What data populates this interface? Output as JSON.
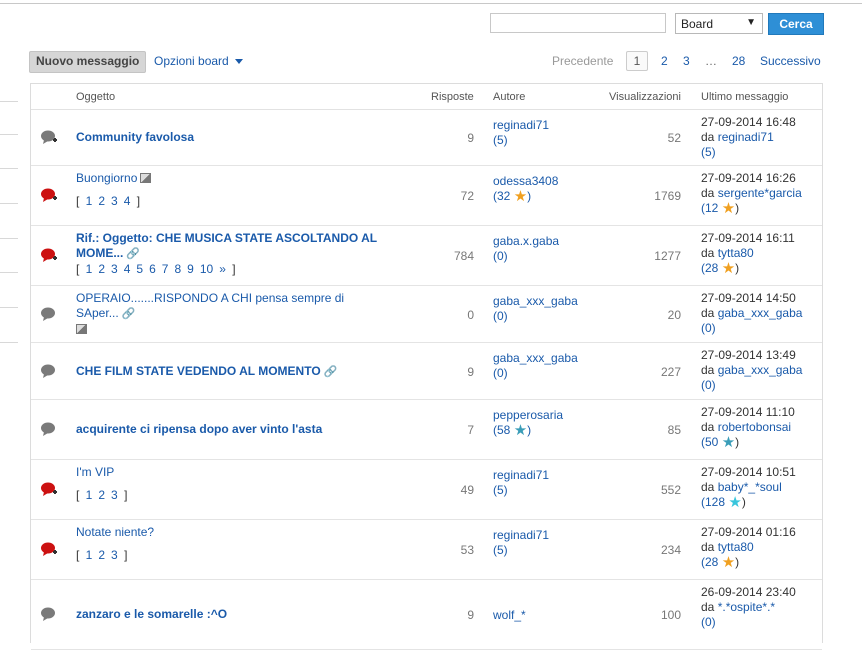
{
  "search": {
    "input_value": "",
    "scope_selected": "Board",
    "button_label": "Cerca"
  },
  "toolbar": {
    "new_message_label": "Nuovo messaggio",
    "board_options_label": "Opzioni board"
  },
  "pagination": {
    "prev": "Precedente",
    "current": "1",
    "p2": "2",
    "p3": "3",
    "ellipsis": "…",
    "last": "28",
    "next": "Successivo"
  },
  "columns": {
    "subject": "Oggetto",
    "replies": "Risposte",
    "author": "Autore",
    "views": "Visualizzazioni",
    "last_message": "Ultimo messaggio"
  },
  "threads": [
    {
      "icon": "chat-grey-new-icon",
      "title": "Community favolosa",
      "bold": true,
      "pages": null,
      "replies": "9",
      "author": "reginadi71",
      "author_count": "(5)",
      "views": "52",
      "last_date": "27-09-2014 16:48",
      "last_prefix": "da",
      "last_user": "reginadi71",
      "last_count": "(5)"
    },
    {
      "icon": "chat-red-hot-new-icon",
      "title": "Buongiorno",
      "bold": false,
      "pages": [
        "1",
        "2",
        "3",
        "4"
      ],
      "replies": "72",
      "author": "odessa3408",
      "author_count": "(32",
      "author_star": "gold",
      "views": "1769",
      "last_date": "27-09-2014 16:26",
      "last_prefix": "da",
      "last_user": "sergente*garcia",
      "last_count": "(12",
      "last_star": "gold"
    },
    {
      "icon": "chat-red-hot-new-icon",
      "title": "Rif.: Oggetto: CHE MUSICA STATE ASCOLTANDO AL MOME...",
      "bold": true,
      "pages": [
        "1",
        "2",
        "3",
        "4",
        "5",
        "6",
        "7",
        "8",
        "9",
        "10",
        "»"
      ],
      "replies": "784",
      "author": "gaba.x.gaba",
      "author_count": "(0)",
      "views": "1277",
      "last_date": "27-09-2014 16:11",
      "last_prefix": "da",
      "last_user": "tytta80",
      "last_count": "(28",
      "last_star": "gold"
    },
    {
      "icon": "chat-grey-icon",
      "title": "OPERAIO.......RISPONDO A CHI pensa sempre di SAper...",
      "bold": false,
      "pages": null,
      "replies": "0",
      "author": "gaba_xxx_gaba",
      "author_count": "(0)",
      "views": "20",
      "last_date": "27-09-2014 14:50",
      "last_prefix": "da",
      "last_user": "gaba_xxx_gaba",
      "last_count": "(0)"
    },
    {
      "icon": "chat-grey-icon",
      "title": "CHE FILM STATE VEDENDO AL MOMENTO",
      "bold": true,
      "pages": null,
      "replies": "9",
      "author": "gaba_xxx_gaba",
      "author_count": "(0)",
      "views": "227",
      "last_date": "27-09-2014 13:49",
      "last_prefix": "da",
      "last_user": "gaba_xxx_gaba",
      "last_count": "(0)"
    },
    {
      "icon": "chat-grey-icon",
      "title": "acquirente ci ripensa dopo aver vinto l'asta",
      "bold": true,
      "pages": null,
      "replies": "7",
      "author": "pepperosaria",
      "author_count": "(58",
      "author_star": "teal",
      "views": "85",
      "last_date": "27-09-2014 11:10",
      "last_prefix": "da",
      "last_user": "robertobonsai",
      "last_count": "(50",
      "last_star": "teal"
    },
    {
      "icon": "chat-red-hot-new-icon",
      "title": "I'm VIP",
      "bold": false,
      "pages": [
        "1",
        "2",
        "3"
      ],
      "replies": "49",
      "author": "reginadi71",
      "author_count": "(5)",
      "views": "552",
      "last_date": "27-09-2014 10:51",
      "last_prefix": "da",
      "last_user": "baby*_*soul",
      "last_count": "(128",
      "last_star": "cyan"
    },
    {
      "icon": "chat-red-hot-new-icon",
      "title": "Notate niente?",
      "bold": false,
      "pages": [
        "1",
        "2",
        "3"
      ],
      "replies": "53",
      "author": "reginadi71",
      "author_count": "(5)",
      "views": "234",
      "last_date": "27-09-2014 01:16",
      "last_prefix": "da",
      "last_user": "tytta80",
      "last_count": "(28",
      "last_star": "gold"
    },
    {
      "icon": "chat-grey-icon",
      "title": "zanzaro e le somarelle :^O",
      "bold": true,
      "pages": null,
      "replies": "9",
      "author": "wolf_*",
      "author_count": "",
      "views": "100",
      "last_date": "26-09-2014 23:40",
      "last_prefix": "da",
      "last_user": "*.*ospite*.*",
      "last_count": "(0)"
    }
  ],
  "colors": {
    "link": "#1a5aaa",
    "button": "#2e8fd6",
    "star_gold": "#f0a020",
    "star_teal": "#3a9db8",
    "star_cyan": "#38c5dc",
    "hot_icon": "#cc1111",
    "normal_icon": "#7a7a7a"
  }
}
